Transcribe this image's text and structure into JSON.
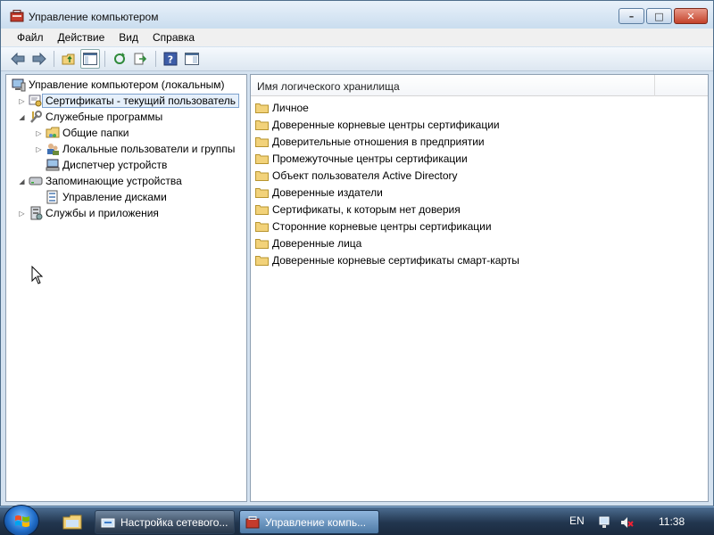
{
  "window": {
    "title": "Управление компьютером",
    "buttons": {
      "minimize": "–",
      "maximize": "□",
      "close": "✕"
    }
  },
  "menu": [
    "Файл",
    "Действие",
    "Вид",
    "Справка"
  ],
  "toolbar": {
    "icons": [
      "back-arrow-icon",
      "forward-arrow-icon",
      "up-folder-icon",
      "show-hide-tree-icon",
      "refresh-icon",
      "export-list-icon",
      "help-icon",
      "properties-icon"
    ]
  },
  "tree": {
    "root": "Управление компьютером (локальным)",
    "certificates": "Сертификаты - текущий пользователь",
    "utilities": "Служебные программы",
    "shared_folders": "Общие папки",
    "local_users": "Локальные пользователи и группы",
    "device_manager": "Диспетчер устройств",
    "storage": "Запоминающие устройства",
    "disk_management": "Управление дисками",
    "services": "Службы и приложения"
  },
  "list": {
    "column_header": "Имя логического хранилища",
    "items": [
      "Личное",
      "Доверенные корневые центры сертификации",
      "Доверительные отношения в предприятии",
      "Промежуточные центры сертификации",
      "Объект пользователя Active Directory",
      "Доверенные издатели",
      "Сертификаты, к которым нет доверия",
      "Сторонние корневые центры сертификации",
      "Доверенные лица",
      "Доверенные корневые сертификаты смарт-карты"
    ]
  },
  "taskbar": {
    "tasks": [
      "Настройка сетевого...",
      "Управление компь..."
    ],
    "language": "EN",
    "clock": "11:38"
  },
  "colors": {
    "folder": "#f2d27a",
    "selection": "#e6f0fb",
    "taskbar": "#22364f"
  }
}
